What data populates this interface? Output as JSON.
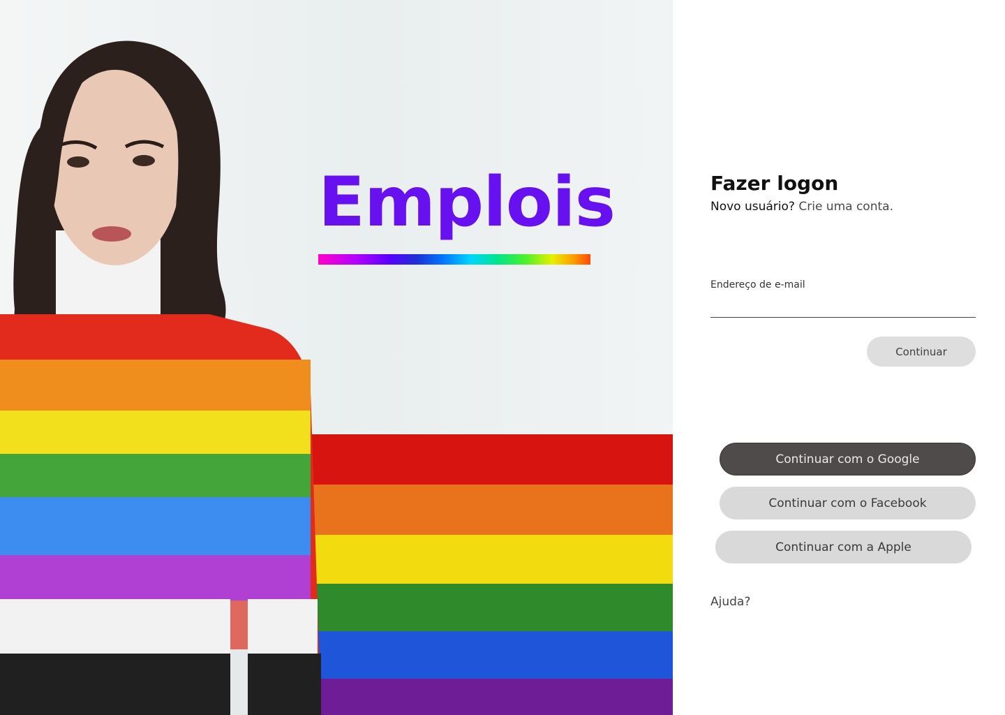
{
  "brand": {
    "name": "Emplois"
  },
  "login": {
    "title": "Fazer logon",
    "new_user_text": "Novo usuário?",
    "create_account_link": "Crie uma conta.",
    "email_label": "Endereço de e-mail",
    "email_value": "",
    "continue_button": "Continuar",
    "google_button": "Continuar com o Google",
    "facebook_button": "Continuar com o Facebook",
    "apple_button": "Continuar com a Apple",
    "help_link": "Ajuda?"
  },
  "colors": {
    "brand_purple": "#6711f0",
    "google_button_bg": "#504b4b",
    "secondary_button_bg": "#d9d9d9"
  }
}
